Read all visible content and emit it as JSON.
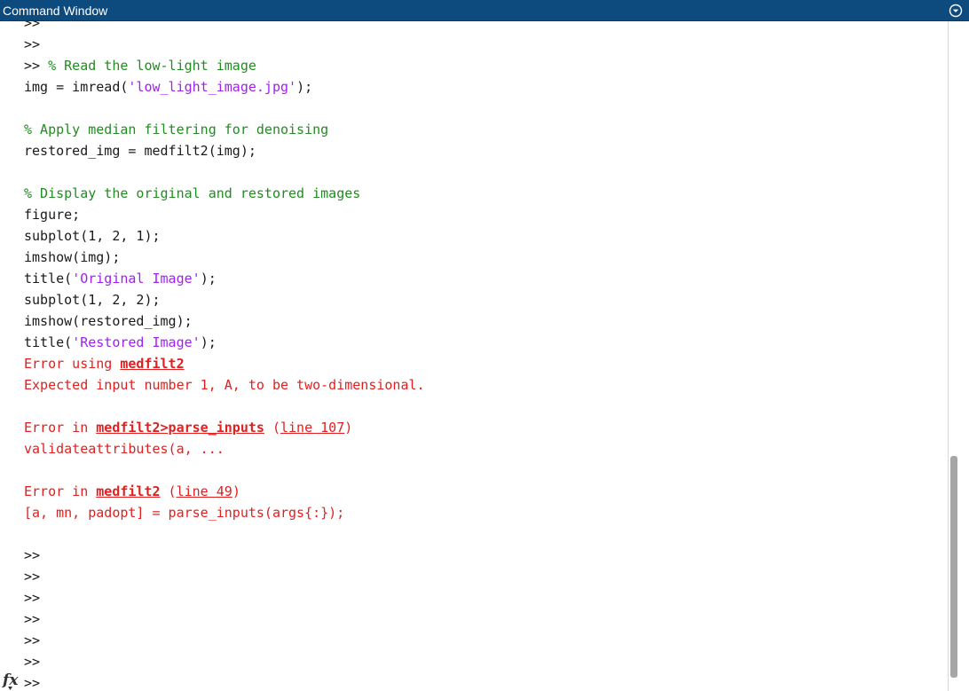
{
  "window": {
    "title": "Command Window",
    "fx_label": "fx"
  },
  "lines": [
    [
      {
        "t": ">>",
        "k": "prompt"
      }
    ],
    [
      {
        "t": ">>",
        "k": "prompt"
      }
    ],
    [
      {
        "t": ">> ",
        "k": "prompt"
      },
      {
        "t": "% Read the low-light image",
        "k": "comment"
      }
    ],
    [
      {
        "t": "img = imread(",
        "k": "code"
      },
      {
        "t": "'low_light_image.jpg'",
        "k": "string"
      },
      {
        "t": ");",
        "k": "code"
      }
    ],
    [],
    [
      {
        "t": "% Apply median filtering for denoising",
        "k": "comment"
      }
    ],
    [
      {
        "t": "restored_img = medfilt2(img);",
        "k": "code"
      }
    ],
    [],
    [
      {
        "t": "% Display the original and restored images",
        "k": "comment"
      }
    ],
    [
      {
        "t": "figure;",
        "k": "code"
      }
    ],
    [
      {
        "t": "subplot(1, 2, 1);",
        "k": "code"
      }
    ],
    [
      {
        "t": "imshow(img);",
        "k": "code"
      }
    ],
    [
      {
        "t": "title(",
        "k": "code"
      },
      {
        "t": "'Original Image'",
        "k": "string"
      },
      {
        "t": ");",
        "k": "code"
      }
    ],
    [
      {
        "t": "subplot(1, 2, 2);",
        "k": "code"
      }
    ],
    [
      {
        "t": "imshow(restored_img);",
        "k": "code"
      }
    ],
    [
      {
        "t": "title(",
        "k": "code"
      },
      {
        "t": "'Restored Image'",
        "k": "string"
      },
      {
        "t": ");",
        "k": "code"
      }
    ],
    [
      {
        "t": "Error using ",
        "k": "error"
      },
      {
        "t": "medfilt2",
        "k": "link"
      }
    ],
    [
      {
        "t": "Expected input number 1, A, to be two-dimensional.",
        "k": "error"
      }
    ],
    [],
    [
      {
        "t": "Error in ",
        "k": "error"
      },
      {
        "t": "medfilt2>parse_inputs",
        "k": "link"
      },
      {
        "t": " (",
        "k": "error"
      },
      {
        "t": "line 107",
        "k": "sublink"
      },
      {
        "t": ")",
        "k": "error"
      }
    ],
    [
      {
        "t": "validateattributes(a, ...",
        "k": "error"
      }
    ],
    [],
    [
      {
        "t": "Error in ",
        "k": "error"
      },
      {
        "t": "medfilt2",
        "k": "link"
      },
      {
        "t": " (",
        "k": "error"
      },
      {
        "t": "line 49",
        "k": "sublink"
      },
      {
        "t": ")",
        "k": "error"
      }
    ],
    [
      {
        "t": "[a, mn, padopt] = parse_inputs(args{:});",
        "k": "error"
      }
    ],
    [],
    [
      {
        "t": ">>",
        "k": "prompt"
      }
    ],
    [
      {
        "t": ">>",
        "k": "prompt"
      }
    ],
    [
      {
        "t": ">>",
        "k": "prompt"
      }
    ],
    [
      {
        "t": ">>",
        "k": "prompt"
      }
    ],
    [
      {
        "t": ">>",
        "k": "prompt"
      }
    ],
    [
      {
        "t": ">>",
        "k": "prompt"
      }
    ],
    [
      {
        "t": ">>",
        "k": "prompt"
      }
    ]
  ],
  "colors": {
    "titlebar": "#0d4a7e",
    "comment": "#228b22",
    "string": "#a020f0",
    "error": "#e02020",
    "code": "#1a1a1a"
  }
}
